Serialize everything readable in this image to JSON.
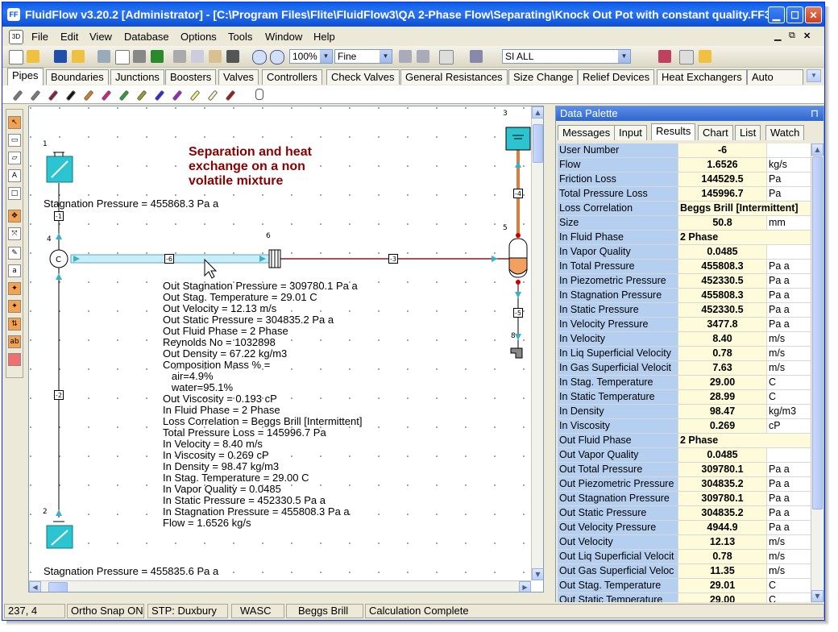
{
  "window": {
    "title": "FluidFlow v3.20.2 [Administrator] - [C:\\Program Files\\Flite\\FluidFlow3\\QA 2-Phase Flow\\Separating\\Knock Out Pot with constant quality.FF3]"
  },
  "menu": [
    "File",
    "Edit",
    "View",
    "Database",
    "Options",
    "Tools",
    "Window",
    "Help"
  ],
  "toolbar": {
    "zoom": "100%",
    "grid": "Fine",
    "units": "SI ALL"
  },
  "component_tabs": [
    "Pipes",
    "Boundaries",
    "Junctions",
    "Boosters",
    "Valves",
    "Controllers",
    "Check Valves",
    "General Resistances",
    "Size Change",
    "Relief Devices",
    "Heat Exchangers",
    "Auto"
  ],
  "pipe_colors": [
    "#7a7a7a",
    "#7a7a7a",
    "#8b1a4a",
    "#111111",
    "#e07b1f",
    "#d81b8a",
    "#2aa02a",
    "#9aa01a",
    "#2a2ad8",
    "#a020c8",
    "#f0f080",
    "#f5f5c0",
    "#a01818"
  ],
  "canvas": {
    "note": [
      "Separation and heat",
      "exchange on a non",
      "volatile mixture"
    ],
    "stag_top": "Stagnation Pressure = 455868.3 Pa a",
    "stag_bottom": "Stagnation Pressure = 455835.6 Pa a",
    "nodes": [
      "1",
      "2",
      "3",
      "4",
      "5",
      "6",
      "8"
    ],
    "pipes": [
      "-1",
      "-2",
      "-3",
      "-4",
      "-5",
      "-6"
    ],
    "results": [
      "Out Stagnation Pressure = 309780.1 Pa a",
      "Out Stag. Temperature = 29.01 C",
      "Out Velocity = 12.13 m/s",
      "Out Static Pressure = 304835.2 Pa a",
      "Out Fluid Phase = 2 Phase",
      "Reynolds No = 1032898",
      "Out Density = 67.22 kg/m3",
      "Composition Mass % =",
      "   air=4.9%",
      "   water=95.1%",
      "Out Viscosity = 0.193 cP",
      "In Fluid Phase = 2 Phase",
      "Loss Correlation = Beggs Brill [Intermittent]",
      "Total Pressure Loss = 145996.7 Pa",
      "In Velocity = 8.40 m/s",
      "In Viscosity = 0.269 cP",
      "In Density = 98.47 kg/m3",
      "In Stag. Temperature = 29.00 C",
      "In Vapor Quality = 0.0485",
      "In Static Pressure = 452330.5 Pa a",
      "In Stagnation Pressure = 455808.3 Pa a",
      "Flow = 1.6526 kg/s"
    ]
  },
  "palette": {
    "title": "Data Palette",
    "pin": "⊓",
    "tabs": [
      "Messages",
      "Input",
      "Results",
      "Chart",
      "List",
      "Watch"
    ],
    "rows": [
      {
        "name": "User Number",
        "value": "-6",
        "unit": ""
      },
      {
        "name": "Flow",
        "value": "1.6526",
        "unit": "kg/s"
      },
      {
        "name": "Friction Loss",
        "value": "144529.5",
        "unit": "Pa"
      },
      {
        "name": "Total Pressure Loss",
        "value": "145996.7",
        "unit": "Pa"
      },
      {
        "name": "Loss Correlation",
        "value": "Beggs Brill [Intermittent]",
        "unit": ""
      },
      {
        "name": "Size",
        "value": "50.8",
        "unit": "mm"
      },
      {
        "name": "In Fluid Phase",
        "value": "2 Phase",
        "unit": ""
      },
      {
        "name": "In Vapor Quality",
        "value": "0.0485",
        "unit": ""
      },
      {
        "name": "In Total Pressure",
        "value": "455808.3",
        "unit": "Pa a"
      },
      {
        "name": "In Piezometric Pressure",
        "value": "452330.5",
        "unit": "Pa a"
      },
      {
        "name": "In Stagnation Pressure",
        "value": "455808.3",
        "unit": "Pa a"
      },
      {
        "name": "In Static Pressure",
        "value": "452330.5",
        "unit": "Pa a"
      },
      {
        "name": "In Velocity Pressure",
        "value": "3477.8",
        "unit": "Pa a"
      },
      {
        "name": "In Velocity",
        "value": "8.40",
        "unit": "m/s"
      },
      {
        "name": "In Liq Superficial Velocity",
        "value": "0.78",
        "unit": "m/s"
      },
      {
        "name": "In Gas Superficial Velocit",
        "value": "7.63",
        "unit": "m/s"
      },
      {
        "name": "In Stag. Temperature",
        "value": "29.00",
        "unit": "C"
      },
      {
        "name": "In Static Temperature",
        "value": "28.99",
        "unit": "C"
      },
      {
        "name": "In Density",
        "value": "98.47",
        "unit": "kg/m3"
      },
      {
        "name": "In Viscosity",
        "value": "0.269",
        "unit": "cP"
      },
      {
        "name": "Out Fluid Phase",
        "value": "2 Phase",
        "unit": ""
      },
      {
        "name": "Out Vapor Quality",
        "value": "0.0485",
        "unit": ""
      },
      {
        "name": "Out Total Pressure",
        "value": "309780.1",
        "unit": "Pa a"
      },
      {
        "name": "Out Piezometric Pressure",
        "value": "304835.2",
        "unit": "Pa a"
      },
      {
        "name": "Out Stagnation Pressure",
        "value": "309780.1",
        "unit": "Pa a"
      },
      {
        "name": "Out Static Pressure",
        "value": "304835.2",
        "unit": "Pa a"
      },
      {
        "name": "Out Velocity Pressure",
        "value": "4944.9",
        "unit": "Pa a"
      },
      {
        "name": "Out Velocity",
        "value": "12.13",
        "unit": "m/s"
      },
      {
        "name": "Out Liq Superficial Velocit",
        "value": "0.78",
        "unit": "m/s"
      },
      {
        "name": "Out Gas Superficial Veloc",
        "value": "11.35",
        "unit": "m/s"
      },
      {
        "name": "Out Stag. Temperature",
        "value": "29.01",
        "unit": "C"
      },
      {
        "name": "Out Static Temperature",
        "value": "29.00",
        "unit": "C"
      }
    ]
  },
  "status": [
    "237, 4",
    "Ortho Snap ON",
    "STP: Duxbury",
    "WASC",
    "Beggs Brill",
    "Calculation Complete"
  ]
}
